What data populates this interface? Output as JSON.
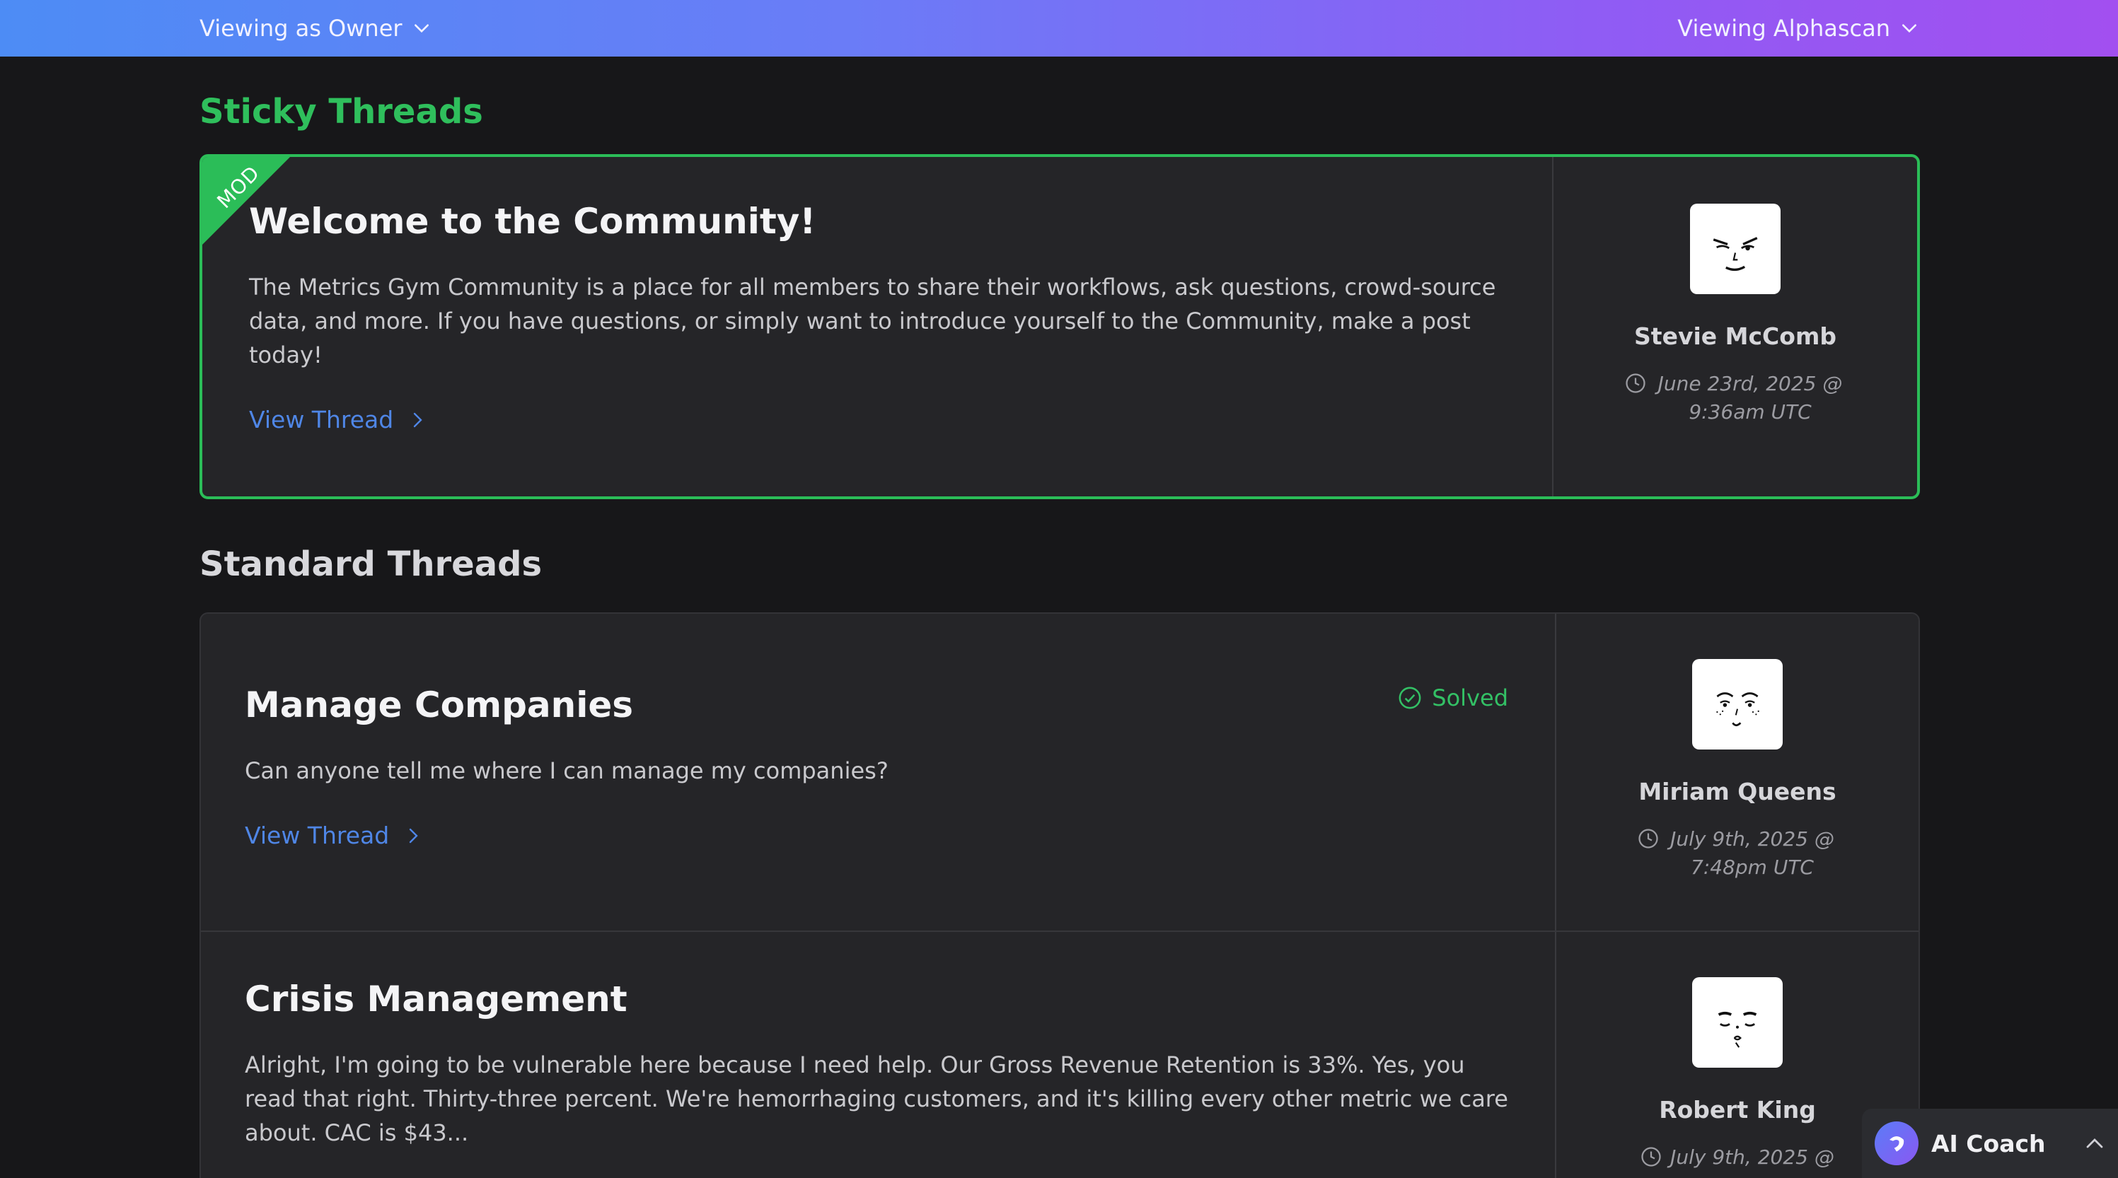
{
  "topbar": {
    "viewing_as": "Viewing as Owner",
    "viewing_org": "Viewing Alphascan"
  },
  "sections": {
    "sticky": "Sticky Threads",
    "standard": "Standard Threads"
  },
  "sticky_thread": {
    "badge": "MOD",
    "title": "Welcome to the Community!",
    "body": "The Metrics Gym Community is a place for all members to share their workflows, ask questions, crowd-source data, and more. If you have questions, or simply want to introduce yourself to the Community, make a post today!",
    "link": "View Thread",
    "author": "Stevie McComb",
    "timestamp": "June 23rd, 2025 @ 9:36am UTC"
  },
  "threads": [
    {
      "title": "Manage Companies",
      "status": "Solved",
      "body": "Can anyone tell me where I can manage my companies?",
      "link": "View Thread",
      "author": "Miriam Queens",
      "timestamp": "July 9th, 2025 @ 7:48pm UTC"
    },
    {
      "title": "Crisis Management",
      "body": "Alright, I'm going to be vulnerable here because I need help. Our Gross Revenue Retention is 33%. Yes, you read that right. Thirty-three percent. We're hemorrhaging customers, and it's killing every other metric we care about. CAC is $43...",
      "author": "Robert King",
      "timestamp": "July 9th, 2025 @"
    }
  ],
  "ai_coach": {
    "label": "AI Coach"
  },
  "colors": {
    "accent_green": "#2bbd58",
    "link_blue": "#4f86e6",
    "background": "#171719",
    "card": "#252528"
  }
}
